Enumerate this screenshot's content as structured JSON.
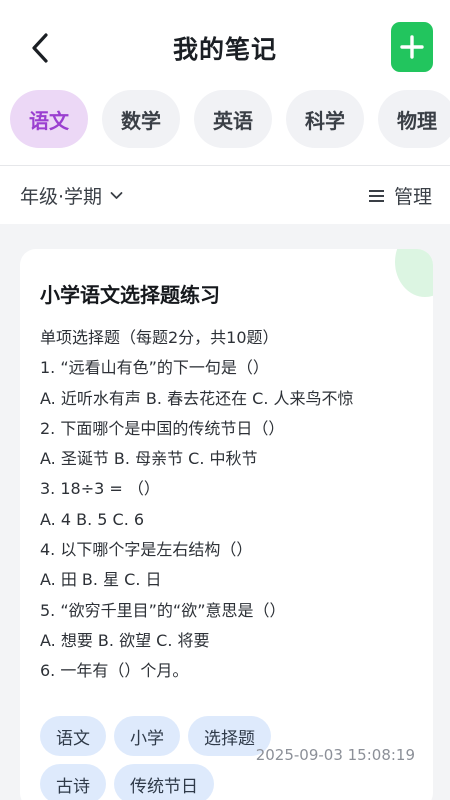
{
  "header": {
    "title": "我的笔记"
  },
  "subjects": [
    {
      "label": "语文",
      "active": true
    },
    {
      "label": "数学",
      "active": false
    },
    {
      "label": "英语",
      "active": false
    },
    {
      "label": "科学",
      "active": false
    },
    {
      "label": "物理",
      "active": false
    }
  ],
  "filter": {
    "grade_label": "年级·学期",
    "manage_label": "管理"
  },
  "note": {
    "title": "小学语文选择题练习",
    "lines": [
      "单项选择题（每题2分，共10题）",
      "1. “远看山有色”的下一句是（）",
      "A. 近听水有声  B. 春去花还在  C. 人来鸟不惊",
      "2. 下面哪个是中国的传统节日（）",
      "A. 圣诞节  B. 母亲节  C. 中秋节",
      "3. 18÷3 = （）",
      "A. 4  B. 5  C. 6",
      "4. 以下哪个字是左右结构（）",
      "A. 田  B. 星  C. 日",
      "5. “欲穷千里目”的“欲”意思是（）",
      "A. 想要  B. 欲望  C. 将要",
      "6. 一年有（）个月。"
    ],
    "tags": [
      "语文",
      "小学",
      "选择题",
      "古诗",
      "传统节日"
    ],
    "timestamp": "2025-09-03 15:08:19"
  },
  "icons": {
    "back": "chevron-left-icon",
    "add": "plus-icon",
    "dropdown": "chevron-down-icon",
    "manage": "menu-lines-icon"
  },
  "colors": {
    "accent_green": "#22c55e",
    "active_tab_bg": "#ecd8f6",
    "active_tab_text": "#9a3fd0",
    "tag_bg": "#deeafc"
  }
}
